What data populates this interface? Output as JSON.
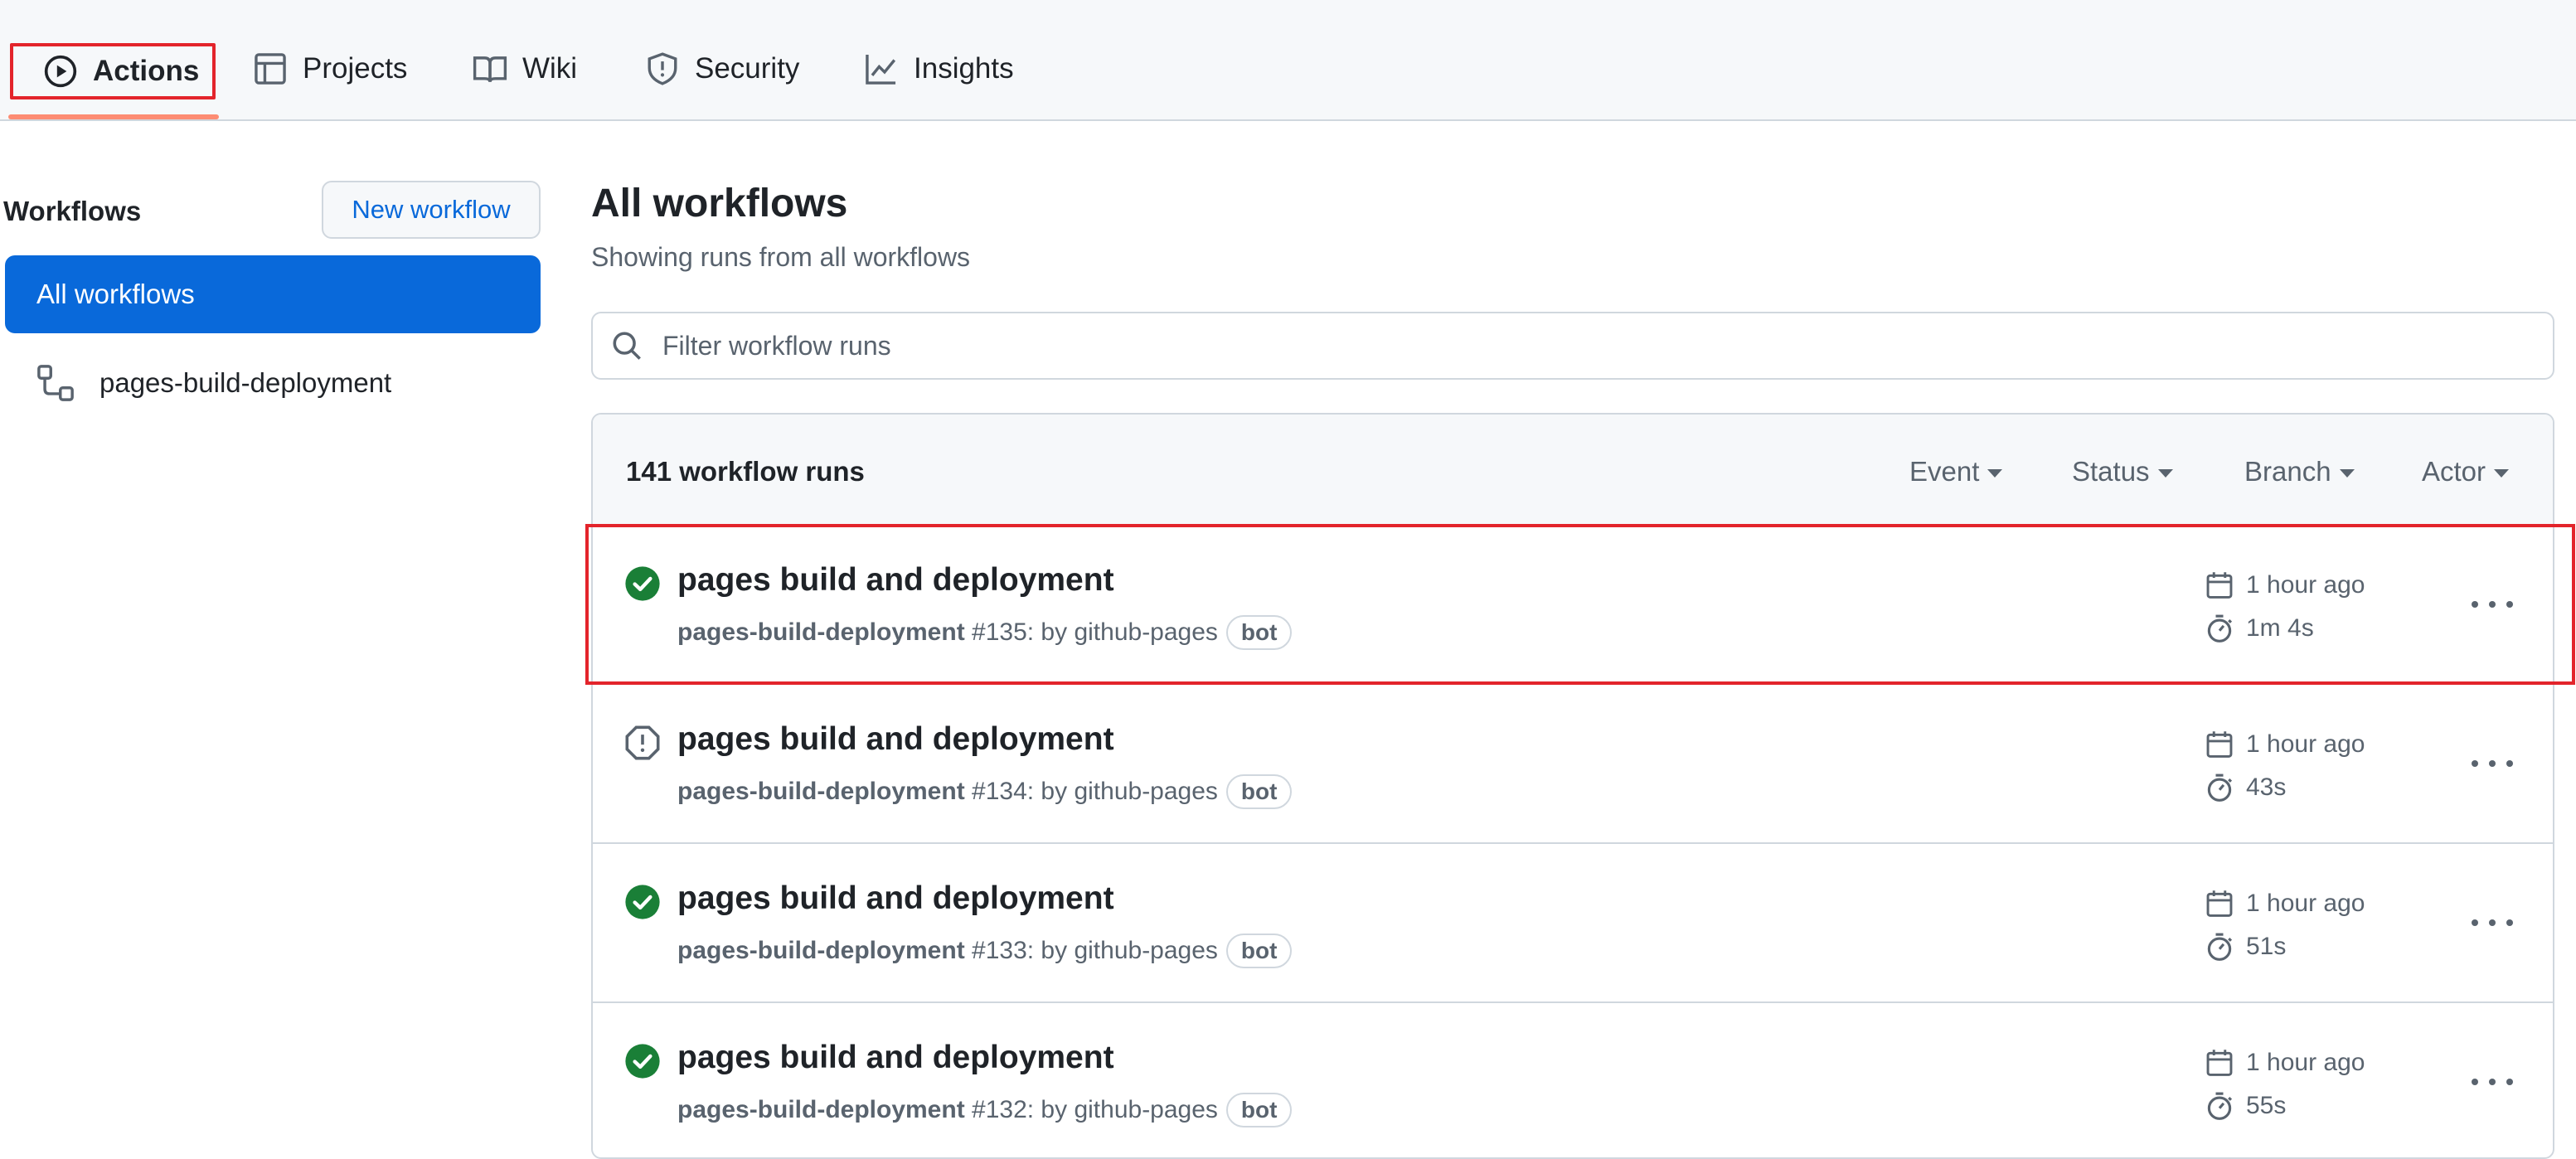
{
  "nav": {
    "tabs": [
      {
        "label": "Actions",
        "icon": "play-icon",
        "selected": true
      },
      {
        "label": "Projects",
        "icon": "table-icon"
      },
      {
        "label": "Wiki",
        "icon": "book-icon"
      },
      {
        "label": "Security",
        "icon": "shield-icon"
      },
      {
        "label": "Insights",
        "icon": "graph-icon"
      }
    ]
  },
  "sidebar": {
    "title": "Workflows",
    "new_workflow_label": "New workflow",
    "items": [
      {
        "label": "All workflows",
        "selected": true
      },
      {
        "label": "pages-build-deployment",
        "icon": "workflow-icon"
      }
    ]
  },
  "main": {
    "title": "All workflows",
    "subtitle": "Showing runs from all workflows",
    "filter_placeholder": "Filter workflow runs",
    "runs_count": "141 workflow runs",
    "filters": [
      "Event",
      "Status",
      "Branch",
      "Actor"
    ],
    "runs": [
      {
        "status": "success",
        "title": "pages build and deployment",
        "workflow": "pages-build-deployment",
        "number": " #135",
        "by": ": by github-pages",
        "badge": "bot",
        "time": "1 hour ago",
        "duration": "1m 4s"
      },
      {
        "status": "warning",
        "title": "pages build and deployment",
        "workflow": "pages-build-deployment",
        "number": " #134",
        "by": ": by github-pages",
        "badge": "bot",
        "time": "1 hour ago",
        "duration": "43s"
      },
      {
        "status": "success",
        "title": "pages build and deployment",
        "workflow": "pages-build-deployment",
        "number": " #133",
        "by": ": by github-pages",
        "badge": "bot",
        "time": "1 hour ago",
        "duration": "51s"
      },
      {
        "status": "success",
        "title": "pages build and deployment",
        "workflow": "pages-build-deployment",
        "number": " #132",
        "by": ": by github-pages",
        "badge": "bot",
        "time": "1 hour ago",
        "duration": "55s"
      }
    ]
  },
  "colors": {
    "accent": "#0969da",
    "success": "#1a7f37",
    "highlight": "#e3242b",
    "underline": "#fd8c73"
  }
}
